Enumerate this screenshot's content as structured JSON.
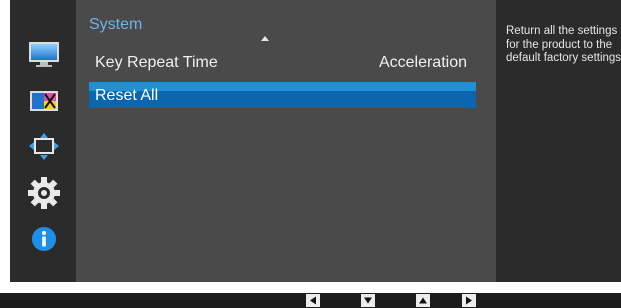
{
  "menu": {
    "title": "System",
    "rows": [
      {
        "label": "Key Repeat Time",
        "value": "Acceleration"
      },
      {
        "label": "Reset All",
        "value": ""
      }
    ],
    "selected_index": 1
  },
  "info": {
    "text": "Return all the settings\nfor the product to the\ndefault factory settings."
  },
  "sidebar": {
    "items": [
      {
        "icon": "picture-icon"
      },
      {
        "icon": "color-icon"
      },
      {
        "icon": "size-position-icon"
      },
      {
        "icon": "system-gear-icon",
        "active": true
      },
      {
        "icon": "information-icon"
      }
    ]
  },
  "nav_keys": [
    "left-arrow-key-icon",
    "down-arrow-key-icon",
    "up-arrow-key-icon",
    "right-arrow-key-icon"
  ],
  "colors": {
    "accent_blue": "#6fb3e6",
    "selection_blue": "#0c66ad",
    "panel_gray": "#4a4a4a",
    "sidebar_dark": "#2b2b2b"
  }
}
